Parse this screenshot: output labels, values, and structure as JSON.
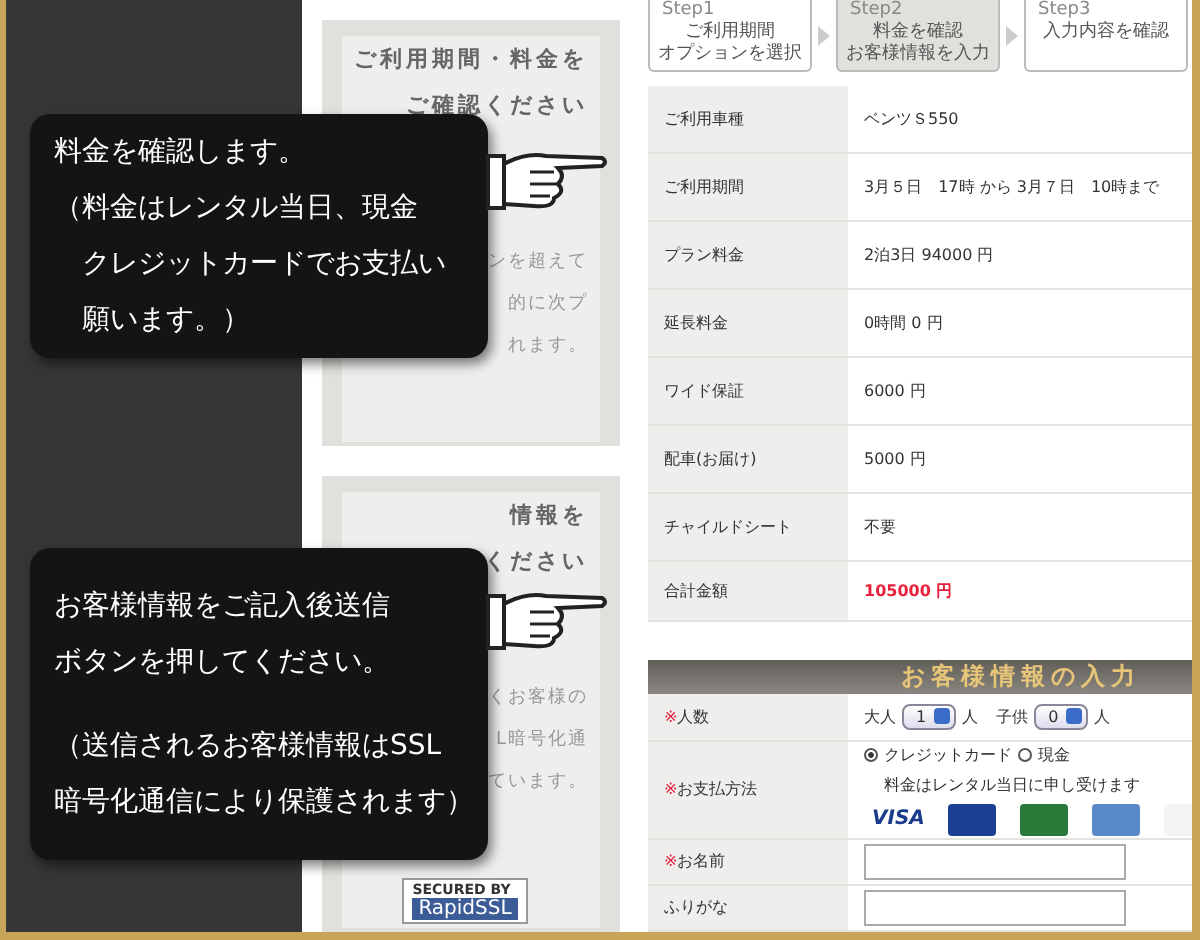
{
  "steps": [
    {
      "label": "Step1",
      "lines": [
        "ご利用期間",
        "オプションを選択"
      ],
      "selected": false
    },
    {
      "label": "Step2",
      "lines": [
        "料金を確認",
        "お客様情報を入力"
      ],
      "selected": true
    },
    {
      "label": "Step3",
      "lines": [
        "入力内容を確認"
      ],
      "selected": false
    }
  ],
  "sidebar": {
    "panels": [
      {
        "heading": [
          "ご利用期間・料金を",
          "ご確認ください"
        ],
        "body": [
          "ンを超えて",
          "的に次プ",
          "れます。"
        ]
      },
      {
        "heading": [
          "情報を",
          "ください"
        ],
        "body": [
          "くお客様の",
          "L暗号化通",
          "ています。"
        ]
      }
    ],
    "badge": {
      "top": "SECURED BY",
      "bottom": "RapidSSL"
    }
  },
  "summary": {
    "rows": [
      {
        "label": "ご利用車種",
        "value": "ベンツＳ550",
        "kind": "plain"
      },
      {
        "label": "ご利用期間",
        "value": "3月５日　17時 から 3月７日　10時まで",
        "kind": "plain"
      },
      {
        "label": "プラン料金",
        "value": "2泊3日 94000 円",
        "kind": "plain"
      },
      {
        "label": "延長料金",
        "value": "0時間 0 円",
        "kind": "plain"
      },
      {
        "label": "ワイド保証",
        "value": "6000 円",
        "kind": "plain"
      },
      {
        "label": "配車(お届け)",
        "value": "5000 円",
        "kind": "plain"
      },
      {
        "label": "チャイルドシート",
        "value": "不要",
        "kind": "plain"
      },
      {
        "label": "合計金額",
        "value": "105000 円",
        "kind": "total"
      }
    ]
  },
  "customer_form": {
    "title": "お客様情報の入力",
    "people": {
      "mark": "※",
      "label": "人数",
      "adult_label": "大人",
      "adult": "1",
      "unit_1": "人",
      "child_label": "子供",
      "child": "0",
      "unit_2": "人"
    },
    "payment": {
      "mark": "※",
      "label": "お支払方法",
      "options": [
        {
          "label": "クレジットカード",
          "selected": true
        },
        {
          "label": "現金",
          "selected": false
        }
      ],
      "note": "料金はレンタル当日に申し受けます",
      "cards": [
        {
          "kind": "visa",
          "label": "VISA"
        },
        {
          "kind": "master"
        },
        {
          "kind": "jcb"
        },
        {
          "kind": "amex"
        },
        {
          "kind": "diners"
        }
      ]
    },
    "name": {
      "mark": "※",
      "label": "お名前"
    },
    "kana": {
      "label": "ふりがな"
    }
  },
  "callouts": [
    {
      "paragraphs": [
        [
          "料金を確認します。",
          "（料金はレンタル当日、現金",
          "　クレジットカードでお支払い",
          "　願います。）"
        ]
      ]
    },
    {
      "paragraphs": [
        [
          "お客様情報をご記入後送信",
          "ボタンを押してください。"
        ],
        [
          "（送信されるお客様情報はSSL",
          "暗号化通信により保護されます）"
        ]
      ]
    }
  ]
}
